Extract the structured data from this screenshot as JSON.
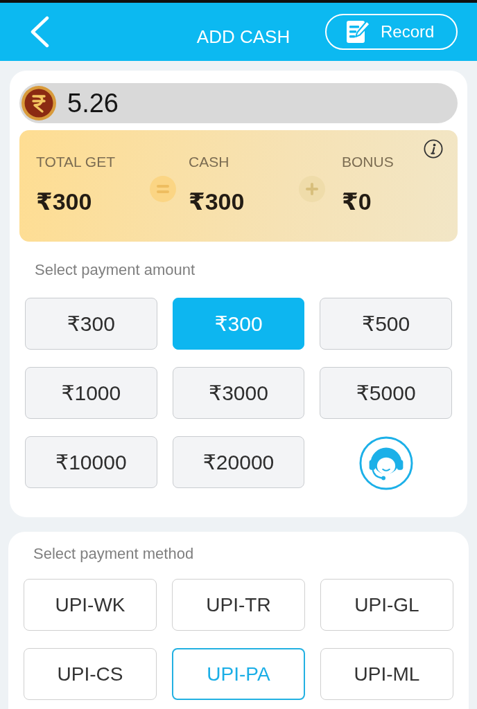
{
  "header": {
    "title": "ADD CASH",
    "record_button": {
      "label": "Record"
    }
  },
  "balance": {
    "amount": "5.26"
  },
  "summary": {
    "columns": [
      {
        "label": "TOTAL GET",
        "value": "₹300"
      },
      {
        "label": "CASH",
        "value": "₹300"
      },
      {
        "label": "BONUS",
        "value": "₹0"
      }
    ]
  },
  "payment_amount": {
    "label": "Select payment amount",
    "options": [
      {
        "label": "₹300",
        "selected": false
      },
      {
        "label": "₹300",
        "selected": true
      },
      {
        "label": "₹500",
        "selected": false
      },
      {
        "label": "₹1000",
        "selected": false
      },
      {
        "label": "₹3000",
        "selected": false
      },
      {
        "label": "₹5000",
        "selected": false
      },
      {
        "label": "₹10000",
        "selected": false
      },
      {
        "label": "₹20000",
        "selected": false
      }
    ]
  },
  "payment_method": {
    "label": "Select payment method",
    "options": [
      {
        "label": "UPI-WK",
        "selected": false
      },
      {
        "label": "UPI-TR",
        "selected": false
      },
      {
        "label": "UPI-GL",
        "selected": false
      },
      {
        "label": "UPI-CS",
        "selected": false
      },
      {
        "label": "UPI-PA",
        "selected": true
      },
      {
        "label": "UPI-ML",
        "selected": false
      }
    ]
  }
}
